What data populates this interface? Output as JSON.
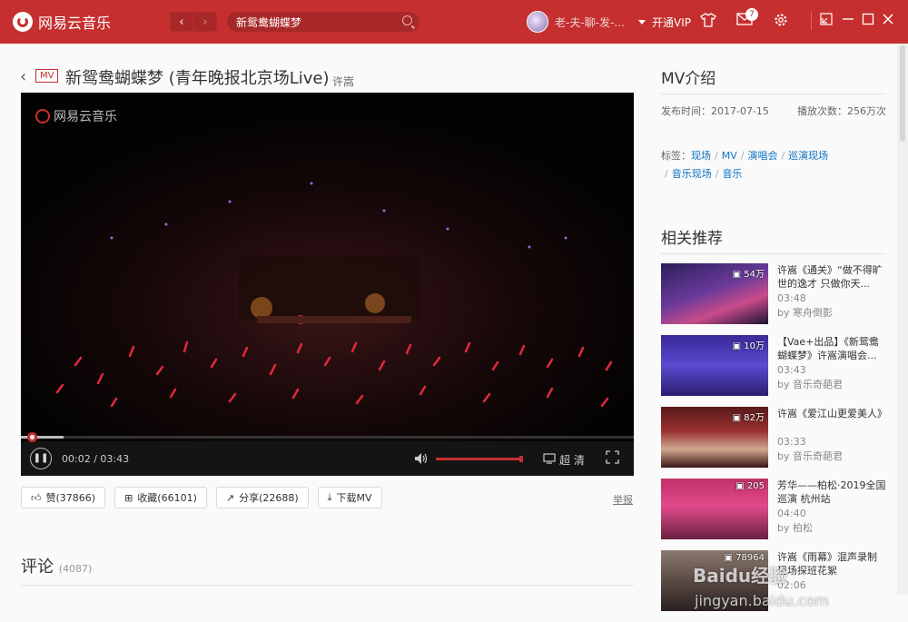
{
  "app": {
    "name": "网易云音乐"
  },
  "search": {
    "value": "新鸳鸯蝴蝶梦"
  },
  "user": {
    "name": "老-夫-聊-发-...",
    "vip_label": "开通VIP",
    "message_count": "7"
  },
  "mv": {
    "tag": "MV",
    "title": "新鸳鸯蝴蝶梦 (青年晚报北京场Live)",
    "artist": "许嵩",
    "watermark": "网易云音乐",
    "time_display": "00:02 / 03:43",
    "quality": "超 清",
    "progress_fraction": 0.01,
    "volume_fraction": 0.98
  },
  "actions": {
    "like": "赞(37866)",
    "collect": "收藏(66101)",
    "share": "分享(22688)",
    "download": "下载MV",
    "report": "举报"
  },
  "comments": {
    "title": "评论",
    "count": "(4087)"
  },
  "intro": {
    "title": "MV介绍",
    "publish": "发布时间：2017-07-15",
    "plays": "播放次数：256万次",
    "tags_label": "标签：",
    "tags": [
      "现场",
      "MV",
      "演唱会",
      "巡演现场",
      "音乐现场",
      "音乐"
    ]
  },
  "related": {
    "title": "相关推荐",
    "items": [
      {
        "plays": "54万",
        "title": "许嵩《通关》“做不得旷世的逸才 只做你天...",
        "duration": "03:48",
        "by": "by 寒舟倒影"
      },
      {
        "plays": "10万",
        "title": "【Vae+出品】《新鸳鸯蝴蝶梦》许嵩演唱会...",
        "duration": "03:43",
        "by": "by 音乐奇葩君"
      },
      {
        "plays": "82万",
        "title": "许嵩《爱江山更爱美人》",
        "duration": "03:33",
        "by": "by 音乐奇葩君"
      },
      {
        "plays": "205",
        "title": "芳华——柏松·2019全国巡演 杭州站",
        "duration": "04:40",
        "by": "by 柏松"
      },
      {
        "plays": "78964",
        "title": "许嵩《雨幕》混声录制现场探班花絮",
        "duration": "02:06",
        "by": ""
      }
    ]
  },
  "watermark_overlay": {
    "baidu": "Baidu经验",
    "jingyan": "jingyan.baidu.com"
  }
}
